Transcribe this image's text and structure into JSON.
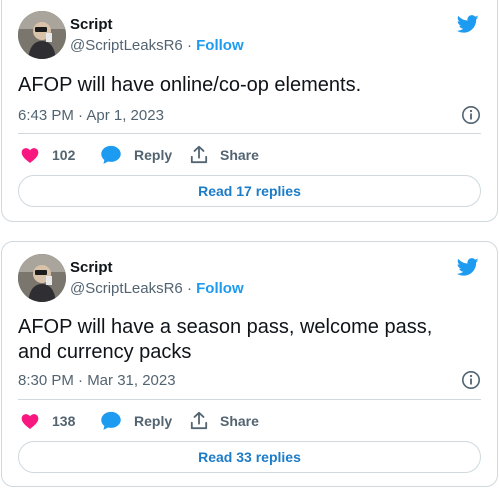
{
  "colors": {
    "accent": "#1d9bf0",
    "like": "#f91880",
    "text": "#0f1419",
    "secondary": "#536471",
    "border": "#cfd9de"
  },
  "tweets": [
    {
      "author_name": "Script",
      "handle": "@ScriptLeaksR6",
      "separator": "·",
      "follow_label": "Follow",
      "text": "AFOP will have online/co-op elements.",
      "timestamp": "6:43 PM · Apr 1, 2023",
      "likes": "102",
      "reply_label": "Reply",
      "share_label": "Share",
      "read_replies_label": "Read 17 replies",
      "icons": [
        "avatar",
        "twitter-bird-icon",
        "info-icon",
        "heart-icon",
        "reply-bubble-icon",
        "share-icon"
      ]
    },
    {
      "author_name": "Script",
      "handle": "@ScriptLeaksR6",
      "separator": "·",
      "follow_label": "Follow",
      "text": "AFOP will have a season pass, welcome pass, and currency packs",
      "timestamp": "8:30 PM · Mar 31, 2023",
      "likes": "138",
      "reply_label": "Reply",
      "share_label": "Share",
      "read_replies_label": "Read 33 replies",
      "icons": [
        "avatar",
        "twitter-bird-icon",
        "info-icon",
        "heart-icon",
        "reply-bubble-icon",
        "share-icon"
      ]
    }
  ]
}
